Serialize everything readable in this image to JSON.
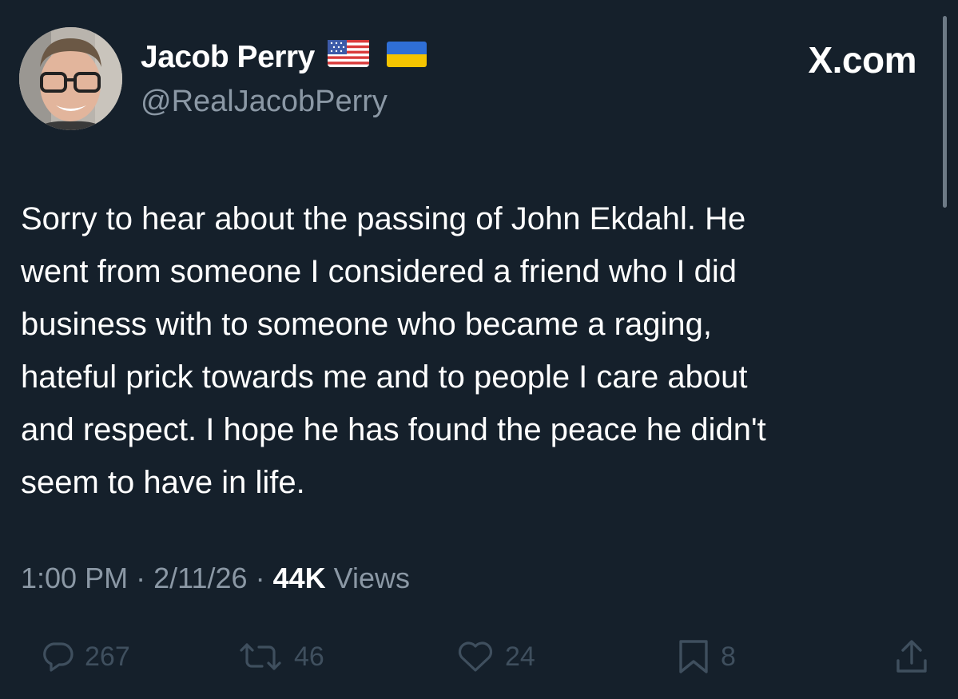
{
  "colors": {
    "background": "#15202b",
    "primary_text": "#ffffff",
    "secondary_text": "#8b98a5",
    "action_icon": "#3f4f5e"
  },
  "author": {
    "display_name": "Jacob Perry",
    "handle": "@RealJacobPerry",
    "badges": [
      "us-flag-icon",
      "ukraine-flag-icon"
    ]
  },
  "brand": {
    "label": "X.com"
  },
  "tweet": {
    "text": "Sorry to hear about the passing of John Ekdahl. He\nwent from someone I considered a friend who I did\nbusiness with to someone who became a raging,\nhateful  prick towards me and to people I care about\nand respect. I hope he has found the peace he didn't\nseem to have in life.",
    "time": "1:00 PM",
    "date": "2/11/26",
    "views_count": "44K",
    "views_label": "Views",
    "separator": "·"
  },
  "actions": {
    "replies": "267",
    "reposts": "46",
    "likes": "24",
    "bookmarks": "8"
  }
}
